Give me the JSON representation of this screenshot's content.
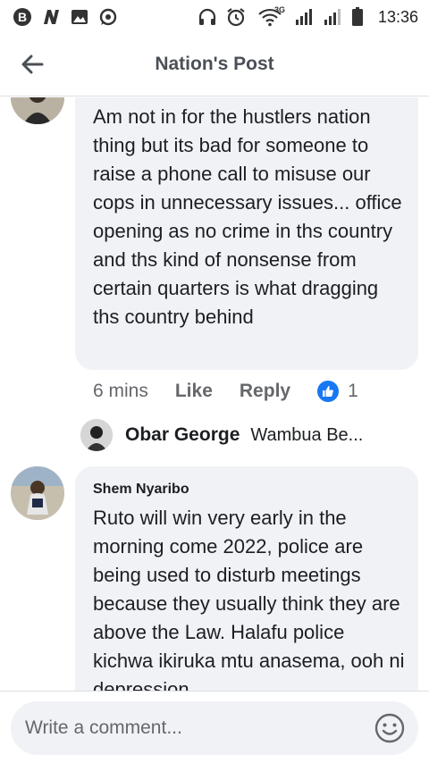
{
  "status_bar": {
    "time": "13:36",
    "network_label": "3G",
    "left_icons": [
      "b-app-icon",
      "n-app-icon",
      "gallery-icon",
      "whatsapp-icon"
    ],
    "right_icons": [
      "headphones-icon",
      "alarm-icon",
      "wifi-icon",
      "signal-icon",
      "signal-icon",
      "battery-icon"
    ]
  },
  "header": {
    "title": "Nation's Post",
    "back_icon": "arrow-left-icon"
  },
  "comments": [
    {
      "text": "Am not in for the hustlers nation thing but its bad for someone to raise a phone call to misuse our cops in unnecessary issues... office opening as no crime in ths country and ths kind of nonsense from certain quarters is what dragging ths country behind",
      "time": "6 mins",
      "like_label": "Like",
      "reply_label": "Reply",
      "reaction_count": "1",
      "reply_preview": {
        "name": "Obar George",
        "snippet": "Wambua Be..."
      }
    },
    {
      "name": "Shem Nyaribo",
      "text": "Ruto will win very early in the morning come 2022, police are being used to disturb meetings because they usually think they are above the Law. Halafu police kichwa ikiruka mtu anasema, ooh ni depression."
    }
  ],
  "composer": {
    "placeholder": "Write a comment...",
    "emoji_icon": "smiley-icon"
  },
  "colors": {
    "bubble": "#f0f2f5",
    "like_blue": "#1877f2",
    "secondary_text": "#65676b",
    "header_text": "#4b4f56"
  }
}
